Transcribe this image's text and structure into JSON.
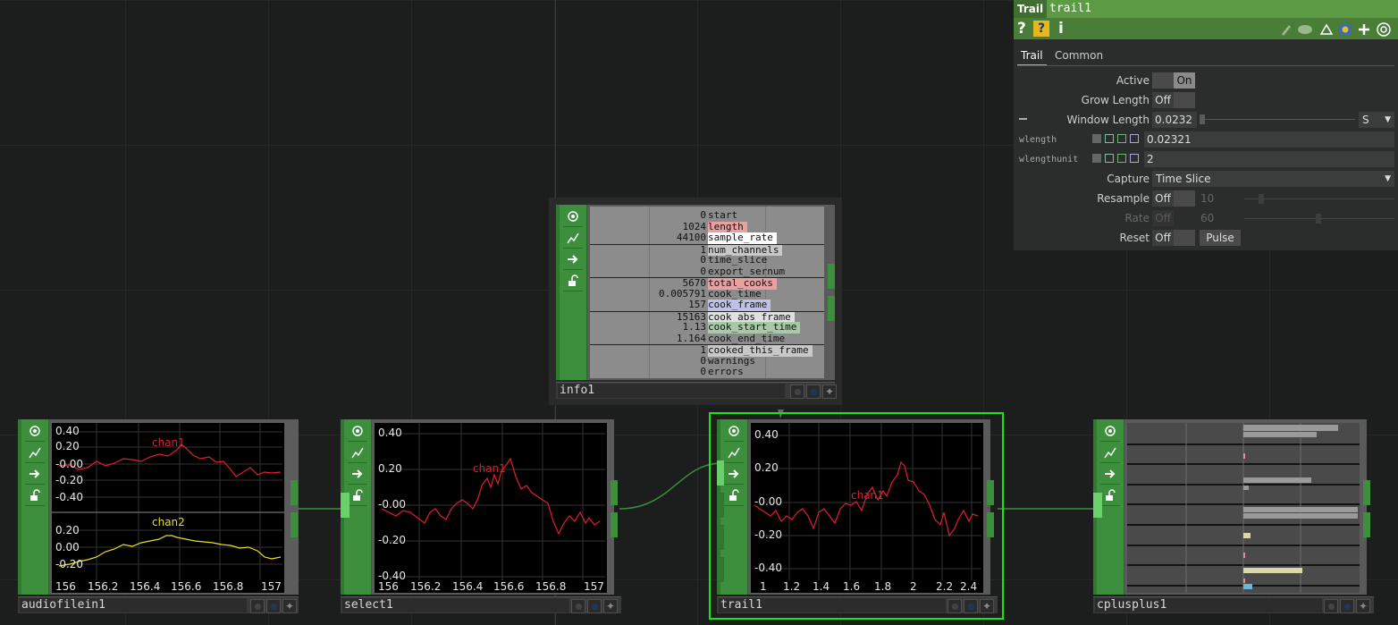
{
  "nodes": {
    "audiofilein": {
      "name": "audiofilein1",
      "ticks_y_top": [
        "0.40",
        "0.20",
        "-0.00",
        "-0.20",
        "-0.40"
      ],
      "ticks_y_bottom": [
        "0.20",
        "0.00",
        "-0.20"
      ],
      "ticks_x": [
        "156",
        "156.2",
        "156.4",
        "156.6",
        "156.8",
        "157"
      ],
      "chan1": "chan1",
      "chan2": "chan2"
    },
    "select": {
      "name": "select1",
      "ticks_y": [
        "0.40",
        "0.20",
        "-0.00",
        "-0.20",
        "-0.40"
      ],
      "ticks_x": [
        "156",
        "156.2",
        "156.4",
        "156.6",
        "156.8",
        "157"
      ],
      "chan1": "chan1"
    },
    "trail": {
      "name": "trail1",
      "ticks_y": [
        "0.40",
        "0.20",
        "-0.00",
        "-0.20",
        "-0.40"
      ],
      "ticks_x": [
        "1",
        "1.2",
        "1.4",
        "1.6",
        "1.8",
        "2",
        "2.2",
        "2.4"
      ],
      "chan1": "chan1"
    },
    "cplusplus": {
      "name": "cplusplus1"
    },
    "info": {
      "name": "info1",
      "rows": [
        {
          "v": "0",
          "k": "start"
        },
        {
          "v": "1024",
          "k": "length"
        },
        {
          "v": "44100",
          "k": "sample_rate"
        },
        {
          "v": "1",
          "k": "num_channels"
        },
        {
          "v": "0",
          "k": "time_slice"
        },
        {
          "v": "0",
          "k": "export_sernum"
        },
        {
          "v": "5670",
          "k": "total_cooks"
        },
        {
          "v": "0.005791",
          "k": "cook_time"
        },
        {
          "v": "157",
          "k": "cook_frame"
        },
        {
          "v": "15163",
          "k": "cook_abs_frame"
        },
        {
          "v": "1.13",
          "k": "cook_start_time"
        },
        {
          "v": "1.164",
          "k": "cook_end_time"
        },
        {
          "v": "1",
          "k": "cooked_this_frame"
        },
        {
          "v": "0",
          "k": "warnings"
        },
        {
          "v": "0",
          "k": "errors"
        }
      ]
    }
  },
  "panel": {
    "type": "Trail",
    "name": "trail1",
    "tabs": [
      "Trail",
      "Common"
    ],
    "active_label": "Active",
    "active_value": "On",
    "grow_label": "Grow Length",
    "grow_value": "Off",
    "window_label": "Window Length",
    "window_value": "0.0232",
    "window_unit": "S",
    "wlength_label": "wlength",
    "wlength_value": "0.02321",
    "wlengthunit_label": "wlengthunit",
    "wlengthunit_value": "2",
    "capture_label": "Capture",
    "capture_value": "Time Slice",
    "resample_label": "Resample",
    "resample_value": "Off",
    "resample_num": "10",
    "rate_label": "Rate",
    "rate_value": "Off",
    "rate_num": "60",
    "reset_label": "Reset",
    "reset_value": "Off",
    "pulse_label": "Pulse"
  },
  "colors": {
    "accent_green": "#3d8e3d",
    "selected_outline": "#19e619",
    "chan1": "#e0202a",
    "chan2": "#e8e020",
    "header_green": "#5c9a44"
  }
}
